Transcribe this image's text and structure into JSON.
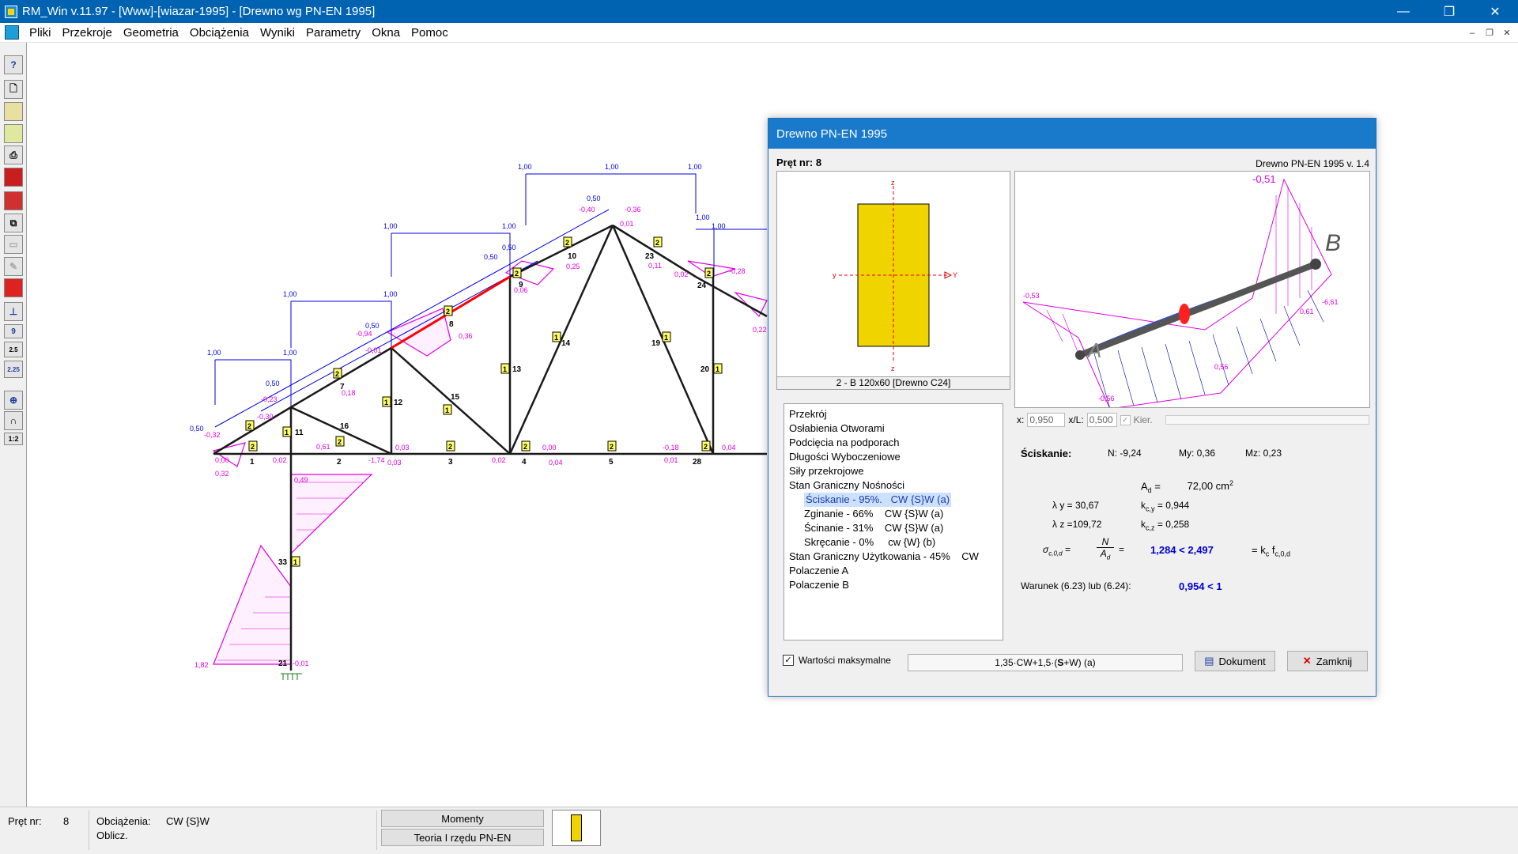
{
  "window": {
    "title": "RM_Win v.11.97 - [Www]-[wiazar-1995] - [Drewno wg PN-EN 1995]"
  },
  "menu": [
    "Pliki",
    "Przekroje",
    "Geometria",
    "Obciążenia",
    "Wyniki",
    "Parametry",
    "Okna",
    "Pomoc"
  ],
  "toolbar": {
    "items": [
      "help-icon",
      "new-file-icon",
      "open-file-icon",
      "import-icon",
      "print-icon",
      "save-icon",
      "material-icon",
      "copy-icon",
      "disabled-icon-1",
      "disabled-icon-2",
      "sections-icon",
      "load-icon",
      "node-icon"
    ],
    "labels": {
      "nine": "9",
      "scale1": "2.5",
      "scale2": "2.25",
      "ratio": "1:2"
    }
  },
  "truss": {
    "load_labels": [
      "1,00",
      "1,00",
      "1,00",
      "1,00",
      "1,00",
      "1,00",
      "1,00",
      "1,00",
      "1,00",
      "1,00",
      "1,00",
      "0,50",
      "0,50",
      "0,50",
      "0,50",
      "0,50",
      "0,50"
    ],
    "member_numbers": [
      "1",
      "2",
      "3",
      "4",
      "5",
      "7",
      "8",
      "9",
      "10",
      "11",
      "12",
      "13",
      "14",
      "15",
      "16",
      "19",
      "20",
      "21",
      "23",
      "24",
      "28",
      "33"
    ],
    "value_labels": [
      "-0,32",
      "0,32",
      "0,00",
      "0,02",
      "-1,74",
      "0,03",
      "0,04",
      "0,61",
      "0,49",
      "1,82",
      "-0,01",
      "0,18",
      "0,36",
      "0,25",
      "0,06",
      "-0,40",
      "-0,36",
      "0,01",
      "0,11",
      "0,02",
      "-0,28",
      "0,22",
      "-0,18",
      "0,01",
      "0,04",
      "0,02",
      "0,00",
      "-0,23",
      "-0,30",
      "-0,94",
      "-0,01",
      "0,03"
    ],
    "section_tags": [
      "2",
      "2",
      "2",
      "2",
      "2",
      "2",
      "2",
      "2",
      "1",
      "1",
      "1",
      "1",
      "1",
      "1",
      "1",
      "1",
      "2",
      "2",
      "2",
      "2",
      "2"
    ]
  },
  "dialog": {
    "title": "Drewno PN-EN 1995",
    "bar_label": "Pręt nr:",
    "bar_number": "8",
    "version": "Drewno PN-EN 1995 v. 1.4",
    "section": {
      "caption": "2 - B 120x60  [Drewno C24]",
      "axis_z": "z",
      "axis_y": "y",
      "axis_Y": "Y",
      "axis_z2": "z",
      "fill": "#f0d400"
    },
    "tree": {
      "items": [
        {
          "label": "Przekrój",
          "indent": 0
        },
        {
          "label": "Osłabienia Otworami",
          "indent": 0
        },
        {
          "label": "Podcięcia na podporach",
          "indent": 0
        },
        {
          "label": "Długości Wyboczeniowe",
          "indent": 0
        },
        {
          "label": "Siły przekrojowe",
          "indent": 0
        },
        {
          "label": "Stan Graniczny Nośności",
          "indent": 0
        }
      ],
      "sub": [
        {
          "label": "Ściskanie - 95%.",
          "comb": "CW {S}W (a)",
          "selected": true
        },
        {
          "label": "Zginanie - 66%",
          "comb": "CW {S}W (a)"
        },
        {
          "label": "Ścinanie - 31%",
          "comb": "CW {S}W (a)"
        },
        {
          "label": "Skręcanie - 0%",
          "comb": "cw {W} (b)"
        }
      ],
      "after": [
        {
          "label": "Stan Graniczny Użytkowania - 45%",
          "comb": "CW"
        },
        {
          "label": "Polaczenie A",
          "comb": ""
        },
        {
          "label": "Polaczenie B",
          "comb": ""
        }
      ]
    },
    "diagram": {
      "label_A": "A",
      "label_B": "B",
      "values": [
        "-0,51",
        "-0,53",
        "-0,51",
        "0,61",
        "-6,61",
        "0,56",
        "-0,56"
      ]
    },
    "position": {
      "x_label": "x:",
      "x_value": "0,950",
      "xl_label": "x/L:",
      "xl_value": "0,500",
      "kier_label": "Kier."
    },
    "results": {
      "title": "Ściskanie:",
      "N": "N: -9,24",
      "My": "My: 0,36",
      "Mz": "Mz: 0,23",
      "Ad_label": "A",
      "Ad_sub": "d",
      "Ad_eq": "=",
      "Ad_value": "72,00 cm",
      "Ad_sup": "2",
      "lambda_y": "λ y =  30,67",
      "kcy_label": "k",
      "kcy_sub": "c,y",
      "kcy_value": "=  0,944",
      "lambda_z": "λ z =109,72",
      "kcz_label": "k",
      "kcz_sub": "c,z",
      "kcz_value": "=  0,258",
      "sigma_label": "σ",
      "sigma_sub": "c,0,d",
      "frac_num": "N",
      "frac_den": "A",
      "frac_den_sub": "d",
      "comparison": "1,284 < 2,497",
      "rhs": "= k",
      "rhs_sub1": "c",
      "rhs_f": "f",
      "rhs_sub2": "c,0,d",
      "condition_label": "Warunek (6.23) lub (6.24):",
      "condition_value": "0,954 < 1"
    },
    "footer": {
      "checkbox_label": "Wartości maksymalne",
      "checked": true,
      "combination_prefix": "1,35·CW+1,5·(",
      "combination_bold": "S",
      "combination_suffix": "+W) (a)",
      "dokument_label": "Dokument",
      "zamknij_label": "Zamknij"
    }
  },
  "status": {
    "bar_label": "Pręt nr:",
    "bar_value": "8",
    "loads_label": "Obciążenia:",
    "loads_value": "CW {S}W",
    "calc_label": "Oblicz.",
    "moments_button": "Momenty",
    "theory_button": "Teoria I rzędu PN-EN"
  },
  "colors": {
    "title_bar": "#0063b1",
    "load": "#0000e0",
    "moment": "#e000e0",
    "active_member": "#ff0000",
    "section_fill": "#f0d400"
  }
}
